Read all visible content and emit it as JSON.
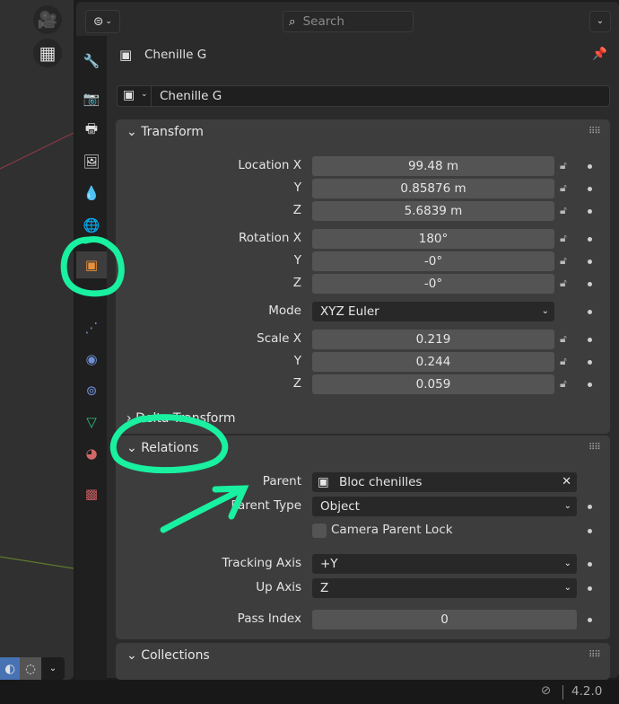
{
  "header": {
    "search_placeholder": "Search"
  },
  "object_name": "Chenille G",
  "datablock_name": "Chenille G",
  "transform": {
    "title": "Transform",
    "rows": [
      {
        "label": "Location X",
        "value": "99.48 m"
      },
      {
        "label": "Y",
        "value": "0.85876 m"
      },
      {
        "label": "Z",
        "value": "5.6839 m"
      },
      {
        "label": "Rotation X",
        "value": "180°"
      },
      {
        "label": "Y",
        "value": "-0°"
      },
      {
        "label": "Z",
        "value": "-0°"
      },
      {
        "label": "Scale X",
        "value": "0.219"
      },
      {
        "label": "Y",
        "value": "0.244"
      },
      {
        "label": "Z",
        "value": "0.059"
      }
    ],
    "mode_label": "Mode",
    "mode_value": "XYZ Euler"
  },
  "delta_transform": {
    "title": "Delta Transform"
  },
  "relations": {
    "title": "Relations",
    "parent_label": "Parent",
    "parent_value": "Bloc chenilles",
    "parent_type_label": "Parent Type",
    "parent_type_value": "Object",
    "camera_parent_lock": "Camera Parent Lock",
    "tracking_axis_label": "Tracking Axis",
    "tracking_axis_value": "+Y",
    "up_axis_label": "Up Axis",
    "up_axis_value": "Z",
    "pass_index_label": "Pass Index",
    "pass_index_value": "0"
  },
  "collections": {
    "title": "Collections"
  },
  "status": {
    "version": "4.2.0"
  },
  "colors": {
    "annotation": "#19f0a0",
    "object_tab": "#e8913c"
  }
}
